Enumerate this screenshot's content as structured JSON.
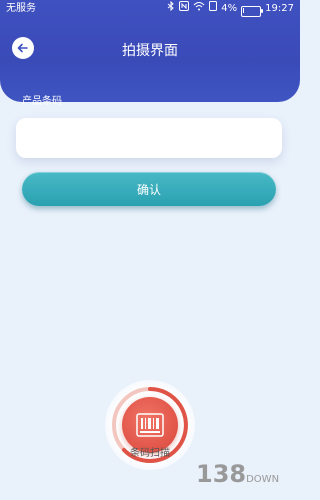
{
  "status_bar": {
    "carrier": "无服务",
    "battery_percent": "4%",
    "time": "19:27"
  },
  "header": {
    "title": "拍摄界面"
  },
  "form": {
    "barcode_label": "产品条码",
    "barcode_value": "",
    "barcode_placeholder": ""
  },
  "actions": {
    "confirm_label": "确认",
    "scan_label": "条码扫描"
  },
  "watermark": {
    "text": "138",
    "suffix": "DOWN"
  },
  "colors": {
    "header": "#3f50c0",
    "confirm": "#2aa1b0",
    "scan": "#e05447",
    "background": "#e9f1fb"
  }
}
